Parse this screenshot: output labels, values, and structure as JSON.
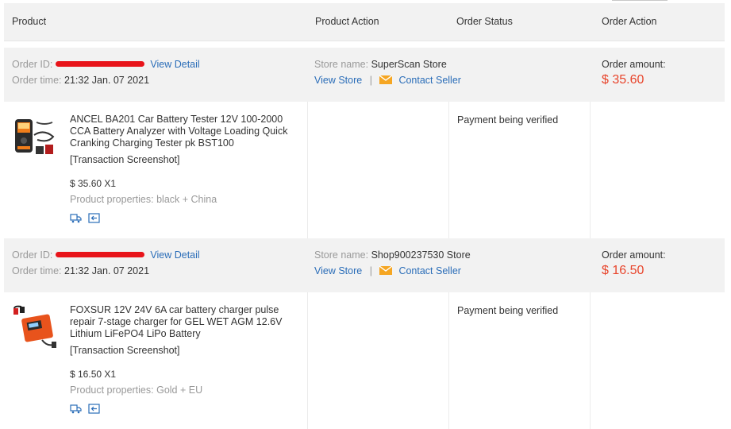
{
  "columns": {
    "product": "Product",
    "product_action": "Product Action",
    "order_status": "Order Status",
    "order_action": "Order Action"
  },
  "labels": {
    "order_id": "Order ID:",
    "order_time": "Order time:",
    "store_name": "Store name:",
    "order_amount": "Order amount:",
    "view_detail": "View Detail",
    "view_store": "View Store",
    "contact_seller": "Contact Seller",
    "screenshot": "[Transaction Screenshot]",
    "props": "Product properties:",
    "sep": "|"
  },
  "orders": [
    {
      "order_time": "21:32 Jan. 07 2021",
      "store_name": "SuperScan Store",
      "amount": "$ 35.60",
      "product_title": "ANCEL BA201 Car Battery Tester 12V 100-2000 CCA Battery Analyzer with Voltage Loading Quick Cranking Charging Tester pk BST100",
      "price_qty": "$ 35.60 X1",
      "properties": "black + China",
      "status": "Payment being verified"
    },
    {
      "order_time": "21:32 Jan. 07 2021",
      "store_name": "Shop900237530 Store",
      "amount": "$ 16.50",
      "product_title": "FOXSUR 12V 24V 6A car battery charger pulse repair 7-stage charger for GEL WET AGM 12.6V Lithium LiFePO4 LiPo Battery",
      "price_qty": "$ 16.50 X1",
      "properties": "Gold + EU",
      "status": "Payment being verified"
    }
  ],
  "colors": {
    "link": "#2a6db8",
    "amount": "#e8452c",
    "header_bg": "#f2f2f2",
    "mail_icon": "#f5a623"
  },
  "icons": [
    "shipping-icon",
    "return-icon",
    "mail-icon"
  ]
}
